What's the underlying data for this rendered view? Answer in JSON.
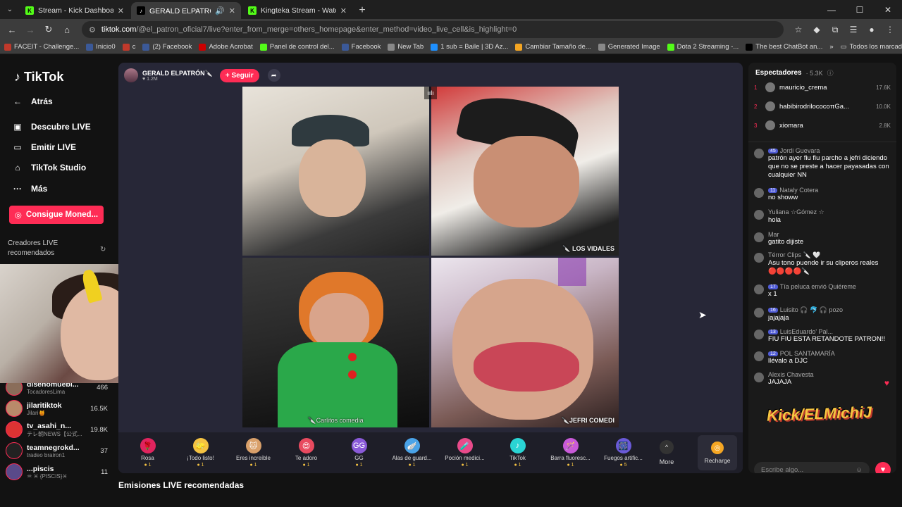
{
  "tabs": [
    {
      "title": "Stream - Kick Dashboard",
      "fav": "K",
      "favColor": "#53fc18",
      "active": false
    },
    {
      "title": "GERALD ELPATRÓN🔪 (@",
      "fav": "♪",
      "favColor": "#000000",
      "active": true
    },
    {
      "title": "Kingteka Stream - Watch Live on",
      "fav": "K",
      "favColor": "#53fc18",
      "active": false
    }
  ],
  "url": {
    "host": "tiktok.com",
    "path": "/@el_patron_oficial7/live?enter_from_merge=others_homepage&enter_method=video_live_cell&is_highlight=0"
  },
  "bookmarks": [
    "FACEIT - Challenge...",
    "Inicio0",
    "c",
    "(2) Facebook",
    "Adobe Acrobat",
    "Panel de control del...",
    "Facebook",
    "New Tab",
    "1 sub = Baile | 3D Az...",
    "Cambiar Tamaño de...",
    "Generated Image",
    "Dota 2 Streaming -...",
    "The best ChatBot an..."
  ],
  "bookmarks_all": "Todos los marcadores",
  "sidebar": {
    "logo": "TikTok",
    "nav": [
      "Atrás",
      "Descubre LIVE",
      "Emitir LIVE",
      "TikTok Studio",
      "Más"
    ],
    "coins": "Consigue Moned...",
    "rec_title": "Creadores LIVE recomendados",
    "creators": [
      {
        "name": "disenomuebl...",
        "sub": "TocadoresLima",
        "count": "466"
      },
      {
        "name": "jilaritiktok",
        "sub": "Jilari🍯",
        "count": "16.5K"
      },
      {
        "name": "tv_asahi_n...",
        "sub": "テレ朝NEWS【公式...",
        "count": "19.8K"
      },
      {
        "name": "teamnegrokd...",
        "sub": "tradeo brairon1",
        "count": "37"
      },
      {
        "name": "...piscis",
        "sub": "♒ ♓ {PISCIS}♓",
        "count": "11"
      }
    ]
  },
  "player": {
    "host_name": "GERALD ELPATRÓN🔪",
    "host_likes": "1.2M",
    "follow": "+ Seguir",
    "cell_labels": [
      "",
      "LOS VIDALES",
      "Carlitos comedia",
      "JEFRI COMEDI"
    ]
  },
  "gifts": [
    {
      "name": "Rosa",
      "icon": "🌹",
      "price": "1"
    },
    {
      "name": "¡Todo listo!",
      "icon": "🧽",
      "price": "1"
    },
    {
      "name": "Eres increíble",
      "icon": "🐱",
      "price": "1"
    },
    {
      "name": "Te adoro",
      "icon": "😍",
      "price": "1"
    },
    {
      "name": "GG",
      "icon": "GG",
      "price": "1"
    },
    {
      "name": "Alas de guard...",
      "icon": "🪽",
      "price": "1"
    },
    {
      "name": "Poción medici...",
      "icon": "🧪",
      "price": "1"
    },
    {
      "name": "TikTok",
      "icon": "♪",
      "price": "1"
    },
    {
      "name": "Barra fluoresc...",
      "icon": "🪄",
      "price": "1"
    },
    {
      "name": "Fuegos artific...",
      "icon": "🎆",
      "price": "5"
    }
  ],
  "more_label": "More",
  "recharge_label": "Recharge",
  "bottom_title": "Emisiones LIVE recomendadas",
  "chat": {
    "viewers_label": "Espectadores",
    "viewers_count": "5.3K",
    "top": [
      {
        "rank": "1",
        "name": "mauricio_crema",
        "score": "17.6K"
      },
      {
        "rank": "2",
        "name": "habibirodrilococoπGa...",
        "score": "10.0K"
      },
      {
        "rank": "3",
        "name": "xiomara",
        "score": "2.8K"
      }
    ],
    "messages": [
      {
        "badge": "45",
        "user": "Jordi Guevara",
        "text": "patrón ayer fiu fiu parcho a jefri diciendo que no se preste a hacer payasadas con cualquier NN"
      },
      {
        "badge": "11",
        "user": "Nataly Cotera",
        "text": "no showw"
      },
      {
        "badge": "",
        "user": "Yuliana ☆Gómez ☆",
        "text": "hola"
      },
      {
        "badge": "",
        "user": "Mar",
        "text": "gatito dijiste"
      },
      {
        "badge": "",
        "user": "Térror Clips 🔪 🤍",
        "text": "Asu tono puende ir su cliperos reales 🔴🔴🔴🔴🔪"
      },
      {
        "badge": "17",
        "user": "Tía peluca envió Quiéreme",
        "text": "x 1"
      },
      {
        "badge": "16",
        "user": "Luisito 🎧 🐬 🎧 pozo",
        "text": "jajajaja"
      },
      {
        "badge": "13",
        "user": "LuisEduardo' Pal...",
        "text": "FIU FIU ESTA RETANDOTE PATRON!!"
      },
      {
        "badge": "12",
        "user": "POL SANTAMARÍA",
        "text": "llévalo a DJC"
      },
      {
        "badge": "",
        "user": "Alexis Chavesta",
        "text": "JAJAJA"
      }
    ],
    "input_placeholder": "Escribe algo..."
  },
  "watermark": "Kick/ELMichiJ"
}
